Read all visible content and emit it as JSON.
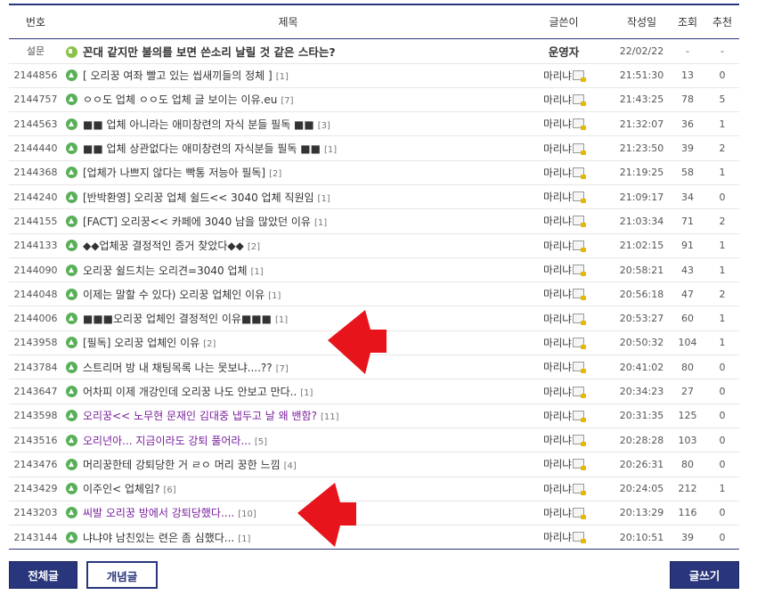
{
  "header": {
    "num": "번호",
    "subject": "제목",
    "writer": "글쓴이",
    "date": "작성일",
    "views": "조회",
    "recommend": "추천"
  },
  "notice": {
    "num": "설문",
    "icon": "speaker-icon",
    "title": "꼰대 같지만 불의를 보면 쓴소리 날릴 것 같은 스타는?",
    "writer": "운영자",
    "date": "22/02/22",
    "views": "-",
    "recommend": "-"
  },
  "posts": [
    {
      "num": "2144856",
      "title": "[ 오리꿍 여좌 빨고 있는 씹새끼들의 정체 ]",
      "comments": "[1]",
      "writer": "마리냐",
      "time": "21:51:30",
      "views": "13",
      "rec": "0",
      "visited": false
    },
    {
      "num": "2144757",
      "title": "ㅇㅇ도 업체 ㅇㅇ도 업체 글 보이는 이유.eu",
      "comments": "[7]",
      "writer": "마리냐",
      "time": "21:43:25",
      "views": "78",
      "rec": "5",
      "visited": false
    },
    {
      "num": "2144563",
      "title": "■■ 업체 아니라는 애미창련의 자식 분들 필독 ■■",
      "comments": "[3]",
      "writer": "마리냐",
      "time": "21:32:07",
      "views": "36",
      "rec": "1",
      "visited": false
    },
    {
      "num": "2144440",
      "title": "■■ 업체 상관없다는 애미창련의 자식분들 필독 ■■",
      "comments": "[1]",
      "writer": "마리냐",
      "time": "21:23:50",
      "views": "39",
      "rec": "2",
      "visited": false
    },
    {
      "num": "2144368",
      "title": "[업체가 나쁘지 않다는 빡통 저능아 필독]",
      "comments": "[2]",
      "writer": "마리냐",
      "time": "21:19:25",
      "views": "58",
      "rec": "1",
      "visited": false
    },
    {
      "num": "2144240",
      "title": "[반박환영] 오리꿍 업체 쉴드<< 3040 업체 직원임",
      "comments": "[1]",
      "writer": "마리냐",
      "time": "21:09:17",
      "views": "34",
      "rec": "0",
      "visited": false
    },
    {
      "num": "2144155",
      "title": "[FACT] 오리꿍<< 카페에 3040 남을 많았던 이유",
      "comments": "[1]",
      "writer": "마리냐",
      "time": "21:03:34",
      "views": "71",
      "rec": "2",
      "visited": false
    },
    {
      "num": "2144133",
      "title": "◆◆업체꿍 결정적인 증거 찾았다◆◆",
      "comments": "[2]",
      "writer": "마리냐",
      "time": "21:02:15",
      "views": "91",
      "rec": "1",
      "visited": false
    },
    {
      "num": "2144090",
      "title": "오리꿍 쉴드치는 오리견=3040 업체",
      "comments": "[1]",
      "writer": "마리냐",
      "time": "20:58:21",
      "views": "43",
      "rec": "1",
      "visited": false
    },
    {
      "num": "2144048",
      "title": "이제는 말할 수 있다) 오리꿍 업체인 이유",
      "comments": "[1]",
      "writer": "마리냐",
      "time": "20:56:18",
      "views": "47",
      "rec": "2",
      "visited": false
    },
    {
      "num": "2144006",
      "title": "■■■오리꿍 업체인 결정적인 이유■■■",
      "comments": "[1]",
      "writer": "마리냐",
      "time": "20:53:27",
      "views": "60",
      "rec": "1",
      "visited": false
    },
    {
      "num": "2143958",
      "title": "[필독] 오리꿍 업체인 이유",
      "comments": "[2]",
      "writer": "마리냐",
      "time": "20:50:32",
      "views": "104",
      "rec": "1",
      "visited": false
    },
    {
      "num": "2143784",
      "title": "스트리머 방 내 채팅목록 나는 못보냐....??",
      "comments": "[7]",
      "writer": "마리냐",
      "time": "20:41:02",
      "views": "80",
      "rec": "0",
      "visited": false
    },
    {
      "num": "2143647",
      "title": "어차피 이제 개강인데 오리꿍 나도 안보고 만다..",
      "comments": "[1]",
      "writer": "마리냐",
      "time": "20:34:23",
      "views": "27",
      "rec": "0",
      "visited": false
    },
    {
      "num": "2143598",
      "title": "오리꿍<< 노무현 문재인 김대중 냅두고 날 왜 밴함?",
      "comments": "[11]",
      "writer": "마리냐",
      "time": "20:31:35",
      "views": "125",
      "rec": "0",
      "visited": true
    },
    {
      "num": "2143516",
      "title": "오리년아... 지금이라도 강퇴 풀어라...",
      "comments": "[5]",
      "writer": "마리냐",
      "time": "20:28:28",
      "views": "103",
      "rec": "0",
      "visited": true
    },
    {
      "num": "2143476",
      "title": "머리꿍한테 강퇴당한 거 ㄹㅇ 머리 꿍한 느낌",
      "comments": "[4]",
      "writer": "마리냐",
      "time": "20:26:31",
      "views": "80",
      "rec": "0",
      "visited": false
    },
    {
      "num": "2143429",
      "title": "이주인< 업체임?",
      "comments": "[6]",
      "writer": "마리냐",
      "time": "20:24:05",
      "views": "212",
      "rec": "1",
      "visited": false
    },
    {
      "num": "2143203",
      "title": "씨발 오리꿍 방에서 강퇴당했다....",
      "comments": "[10]",
      "writer": "마리냐",
      "time": "20:13:29",
      "views": "116",
      "rec": "0",
      "visited": true
    },
    {
      "num": "2143144",
      "title": "냐냐야 남친있는 련은 좀 심했다...",
      "comments": "[1]",
      "writer": "마리냐",
      "time": "20:10:51",
      "views": "39",
      "rec": "0",
      "visited": false
    }
  ],
  "buttons": {
    "all": "전체글",
    "concept": "개념글",
    "write": "글쓰기"
  },
  "colors": {
    "accent": "#29367c",
    "visited": "#7a1f9c",
    "arrow": "#e8141c",
    "post_icon": "#5ab05a"
  },
  "icons": {
    "post": "post-type-icon",
    "writer_badge": "lock-badge-icon",
    "annotation": "red-arrow-icon"
  }
}
